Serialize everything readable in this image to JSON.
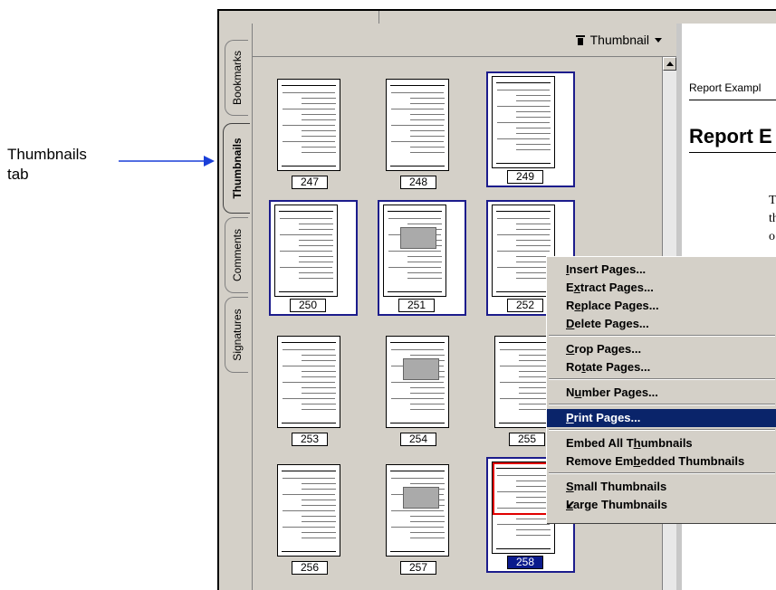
{
  "callout": {
    "line1": "Thumbnails",
    "line2": "tab"
  },
  "tabs": [
    {
      "label": "Bookmarks"
    },
    {
      "label": "Thumbnails"
    },
    {
      "label": "Comments"
    },
    {
      "label": "Signatures"
    }
  ],
  "panel": {
    "menu_label": "Thumbnail",
    "menu_icon": "trash-icon"
  },
  "thumbnails": [
    {
      "num": "247",
      "selected": false
    },
    {
      "num": "248",
      "selected": false
    },
    {
      "num": "249",
      "selected": true
    },
    {
      "num": "250",
      "selected": true
    },
    {
      "num": "251",
      "selected": true
    },
    {
      "num": "252",
      "selected": true
    },
    {
      "num": "253",
      "selected": false
    },
    {
      "num": "254",
      "selected": false
    },
    {
      "num": "255",
      "selected": false
    },
    {
      "num": "256",
      "selected": false
    },
    {
      "num": "257",
      "selected": false
    },
    {
      "num": "258",
      "selected": true
    }
  ],
  "document": {
    "header": "Report Exampl",
    "title": "Report E",
    "text_lines": [
      "T",
      "th",
      "o"
    ]
  },
  "context_menu": {
    "items": [
      {
        "label": "Insert Pages...",
        "underline": "I"
      },
      {
        "label": "Extract Pages...",
        "underline": "x"
      },
      {
        "label": "Replace Pages...",
        "underline": "e"
      },
      {
        "label": "Delete Pages...",
        "underline": "D"
      },
      {
        "label": "Crop Pages...",
        "underline": "C"
      },
      {
        "label": "Rotate Pages...",
        "underline": "t"
      },
      {
        "label": "Number Pages...",
        "underline": "u"
      },
      {
        "label": "Print Pages...",
        "underline": "P",
        "highlighted": true
      },
      {
        "label": "Embed All Thumbnails",
        "underline": "h"
      },
      {
        "label": "Remove Embedded Thumbnails",
        "underline": "b"
      },
      {
        "label": "Small Thumbnails",
        "underline": "S"
      },
      {
        "label": "Large Thumbnails",
        "underline": "L",
        "checked": true
      }
    ]
  },
  "colors": {
    "selection": "#0a246a",
    "thumb_border": "#1c1c8c",
    "crop_box": "#e00000"
  }
}
